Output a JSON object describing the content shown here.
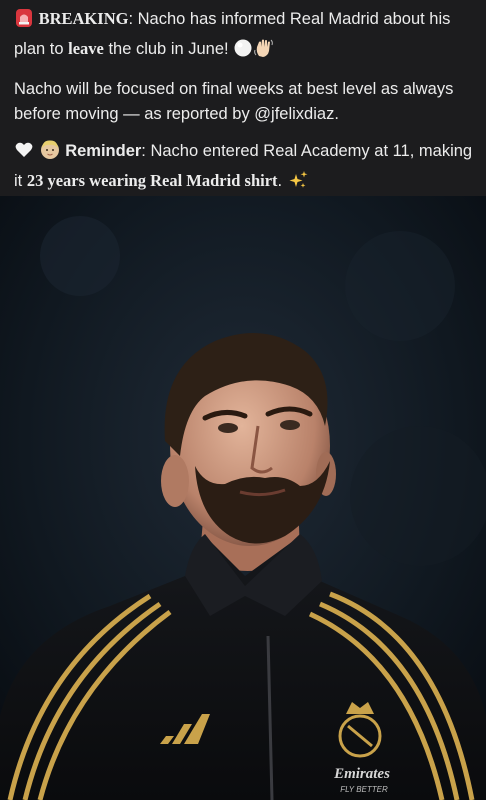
{
  "post": {
    "breaking_label": "BREAKING",
    "breaking_sep": ":",
    "line1_pre": " Nacho has informed Real Madrid about his plan to ",
    "leave_word": "leave",
    "line1_post": " the club in June! ",
    "paragraph2": "Nacho will be focused on final weeks at best level as always before moving — as reported by @jfelixdiaz.",
    "reminder_label": "Reminder",
    "reminder_text": ": Nacho entered Real Academy at 11, making it ",
    "reminder_bold": "23 years wearing Real Madrid shirt",
    "reminder_end": ". "
  },
  "icons": {
    "siren": "siren-icon",
    "ball": "white-circle-icon",
    "wave": "waving-hand-icon",
    "heart": "white-heart-icon",
    "baby": "baby-icon",
    "sparkles": "sparkles-icon"
  },
  "photo": {
    "jersey_sponsor": "Emirates",
    "jersey_tagline": "FLY BETTER"
  },
  "colors": {
    "background": "#1c1c1e",
    "text": "#ececec",
    "gold": "#c9a24a"
  }
}
